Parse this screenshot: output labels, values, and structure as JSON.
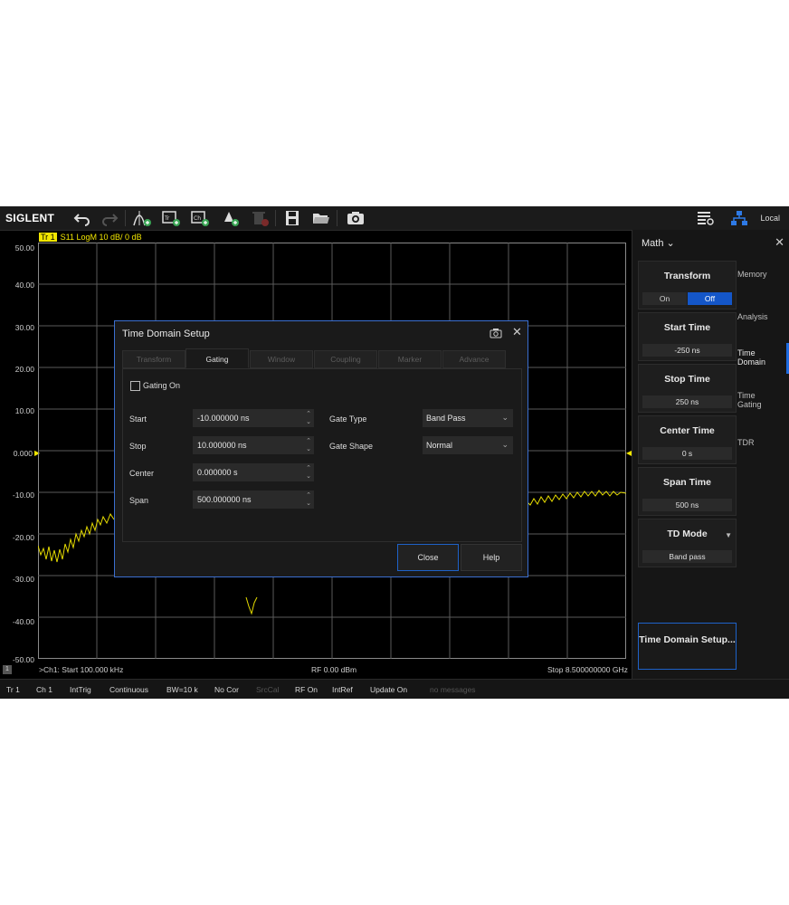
{
  "brand": "SIGLENT",
  "toolbar": {
    "local_label": "Local"
  },
  "trace": {
    "tag": "Tr 1",
    "desc": "S11  LogM  10 dB/  0 dB"
  },
  "y_axis_labels": [
    "50.00",
    "40.00",
    "30.00",
    "20.00",
    "10.00",
    "0.000",
    "-10.00",
    "-20.00",
    "-30.00",
    "-40.00",
    "-50.00"
  ],
  "bottom_status": {
    "ch_index": "1",
    "start": ">Ch1: Start 100.000 kHz",
    "power": "RF 0.00 dBm",
    "stop": "Stop 8.500000000 GHz"
  },
  "statusbar": [
    "Tr 1",
    "Ch 1",
    "IntTrig",
    "Continuous",
    "BW=10 k",
    "No Cor",
    "SrcCal",
    "RF On",
    "IntRef",
    "Update On",
    "no messages"
  ],
  "right_panel": {
    "title": "Math ⌄",
    "transform": {
      "label": "Transform",
      "on": "On",
      "off": "Off"
    },
    "start_time": {
      "label": "Start Time",
      "value": "-250 ns"
    },
    "stop_time": {
      "label": "Stop Time",
      "value": "250 ns"
    },
    "center_time": {
      "label": "Center Time",
      "value": "0 s"
    },
    "span_time": {
      "label": "Span Time",
      "value": "500 ns"
    },
    "td_mode": {
      "label": "TD Mode",
      "value": "Band pass"
    },
    "tds_button": "Time Domain Setup...",
    "tabs": [
      "Memory",
      "Analysis",
      "Time Domain",
      "Time Gating",
      "TDR"
    ]
  },
  "dialog": {
    "title": "Time Domain Setup",
    "tabs": [
      "Transform",
      "Gating",
      "Window",
      "Coupling",
      "Marker",
      "Advance"
    ],
    "gating_on": "Gating On",
    "fields": [
      {
        "label": "Start",
        "value": "-10.000000 ns"
      },
      {
        "label": "Stop",
        "value": "10.000000 ns"
      },
      {
        "label": "Center",
        "value": "0.000000 s"
      },
      {
        "label": "Span",
        "value": "500.000000 ns"
      }
    ],
    "gate_type": {
      "label": "Gate Type",
      "value": "Band Pass"
    },
    "gate_shape": {
      "label": "Gate Shape",
      "value": "Normal"
    },
    "close": "Close",
    "help": "Help"
  },
  "colors": {
    "trace": "#f2e600",
    "accent": "#1e62c9",
    "background": "#000000"
  }
}
